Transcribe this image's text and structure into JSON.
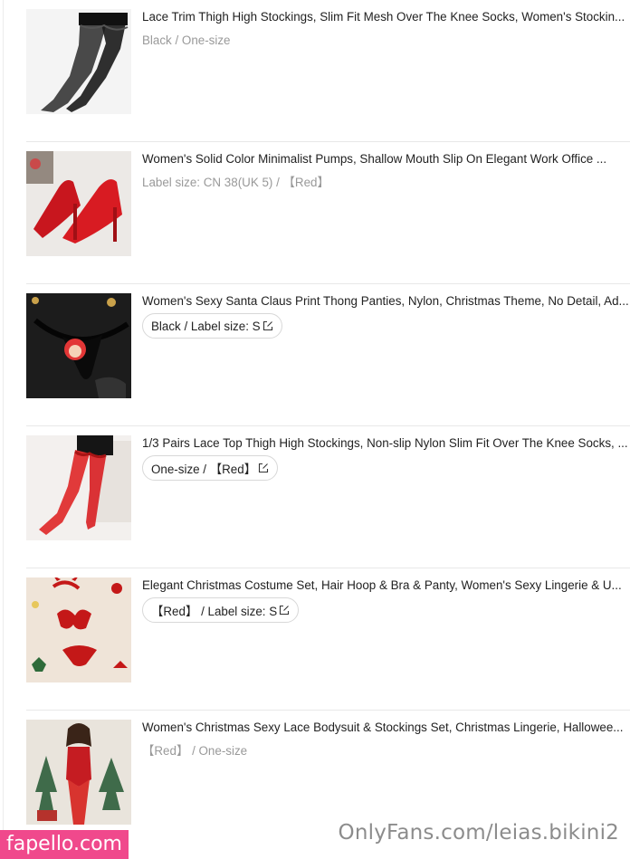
{
  "items": [
    {
      "title": "Lace Trim Thigh High Stockings, Slim Fit Mesh Over The Knee Socks, Women's Stockin...",
      "variant": "Black / One-size",
      "editable": false,
      "thumb_icon": "black-stockings-photo"
    },
    {
      "title": "Women's Solid Color Minimalist Pumps, Shallow Mouth Slip On Elegant Work Office ...",
      "variant": "Label size: CN 38(UK 5) / 【Red】",
      "editable": false,
      "thumb_icon": "red-pumps-photo"
    },
    {
      "title": "Women's Sexy Santa Claus Print Thong Panties, Nylon, Christmas Theme, No Detail, Ad...",
      "variant": "Black / Label size: S",
      "editable": true,
      "thumb_icon": "santa-thong-photo"
    },
    {
      "title": "1/3 Pairs Lace Top Thigh High Stockings, Non-slip Nylon Slim Fit Over The Knee Socks, ...",
      "variant": "One-size / 【Red】",
      "editable": true,
      "thumb_icon": "red-stockings-photo"
    },
    {
      "title": "Elegant Christmas Costume Set, Hair Hoop & Bra & Panty, Women's Sexy Lingerie & U...",
      "variant": "【Red】 / Label size: S",
      "editable": true,
      "thumb_icon": "christmas-lingerie-photo"
    },
    {
      "title": "Women's Christmas Sexy Lace Bodysuit & Stockings Set, Christmas Lingerie, Hallowee...",
      "variant": "【Red】 / One-size",
      "editable": false,
      "thumb_icon": "lace-bodysuit-photo"
    }
  ],
  "watermark": {
    "left": "fapello.com",
    "right": "OnlyFans.com/leias.bikini2"
  },
  "colors": {
    "title": "#222222",
    "variant_muted": "#999999",
    "divider": "#e8e8e8",
    "watermark_badge": "#f0498c"
  }
}
